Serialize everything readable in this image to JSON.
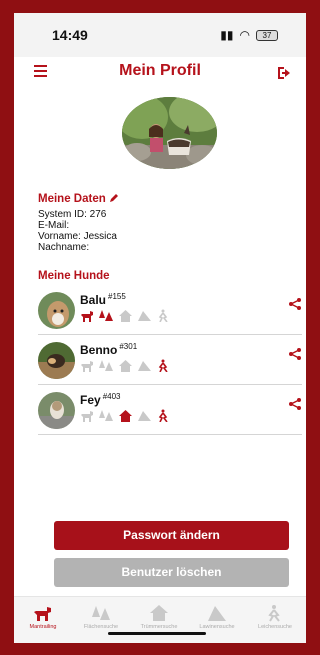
{
  "status": {
    "time": "14:49",
    "battery": "37"
  },
  "header": {
    "title": "Mein Profil"
  },
  "data_section": {
    "title": "Meine Daten",
    "system_id": "System ID: 276",
    "email": "E-Mail:",
    "firstname": "Vorname: Jessica",
    "lastname": "Nachname:"
  },
  "dogs_section": {
    "title": "Meine Hunde",
    "dogs": [
      {
        "name": "Balu",
        "id": "#155"
      },
      {
        "name": "Benno",
        "id": "#301"
      },
      {
        "name": "Fey",
        "id": "#403"
      }
    ]
  },
  "buttons": {
    "change_password": "Passwort ändern",
    "delete_user": "Benutzer löschen"
  },
  "tabs": [
    {
      "label": "Mantrailing"
    },
    {
      "label": "Flächensuche"
    },
    {
      "label": "Trümmersuche"
    },
    {
      "label": "Lawinensuche"
    },
    {
      "label": "Leichensuche"
    }
  ],
  "colors": {
    "accent": "#b5121b",
    "inactive": "#c9c9c9",
    "frame": "#8f0f12"
  }
}
